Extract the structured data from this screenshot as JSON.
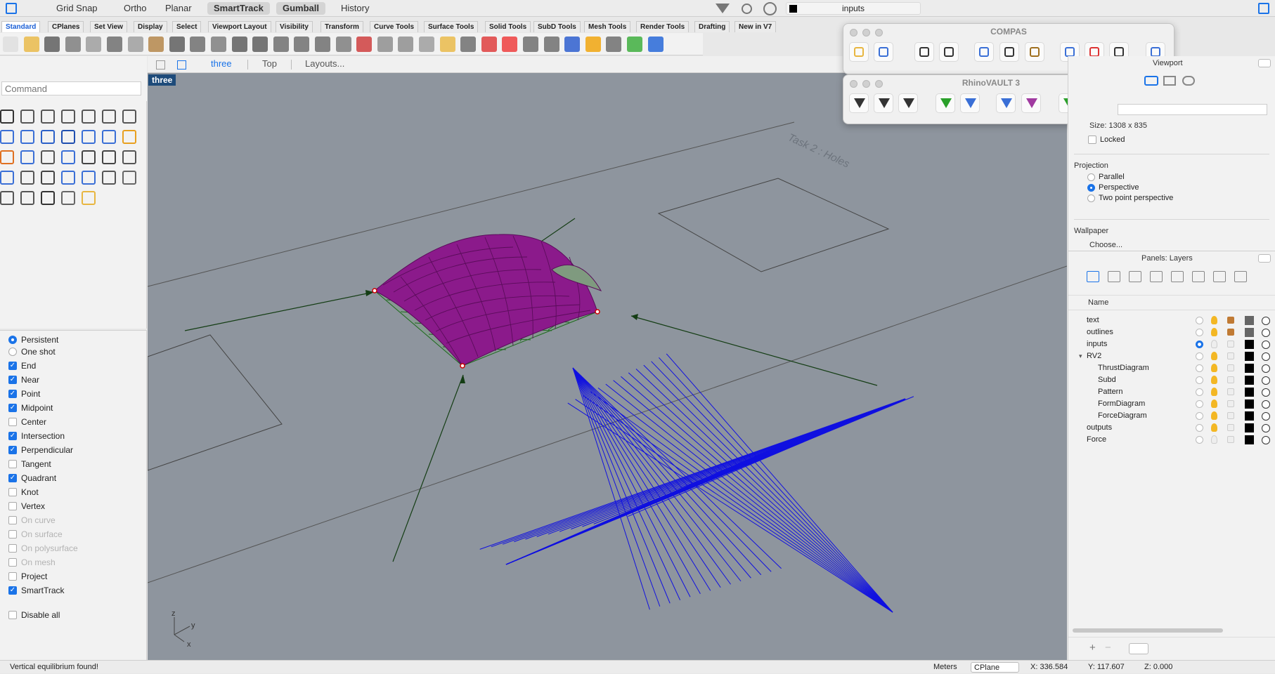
{
  "topbar": {
    "buttons": [
      {
        "label": "Grid Snap",
        "on": false
      },
      {
        "label": "Ortho",
        "on": false
      },
      {
        "label": "Planar",
        "on": false
      },
      {
        "label": "SmartTrack",
        "on": true
      },
      {
        "label": "Gumball",
        "on": true
      },
      {
        "label": "History",
        "on": false
      }
    ],
    "current_layer": "inputs"
  },
  "tabs": [
    "Standard",
    "CPlanes",
    "Set View",
    "Display",
    "Select",
    "Viewport Layout",
    "Visibility",
    "Transform",
    "Curve Tools",
    "Surface Tools",
    "Solid Tools",
    "SubD Tools",
    "Mesh Tools",
    "Render Tools",
    "Drafting",
    "New in V7"
  ],
  "command": {
    "placeholder": "Command"
  },
  "viewport_tabs": {
    "active": "three",
    "items": [
      "three",
      "Top",
      "Layouts..."
    ]
  },
  "viewport": {
    "label": "three",
    "watermark": "Task 2 : Holes",
    "axis_labels": {
      "z": "z",
      "y": "y",
      "x": "x"
    }
  },
  "osnap": {
    "mode": [
      {
        "label": "Persistent",
        "on": true
      },
      {
        "label": "One shot",
        "on": false
      }
    ],
    "items": [
      {
        "label": "End",
        "on": true,
        "dim": false
      },
      {
        "label": "Near",
        "on": true,
        "dim": false
      },
      {
        "label": "Point",
        "on": true,
        "dim": false
      },
      {
        "label": "Midpoint",
        "on": true,
        "dim": false
      },
      {
        "label": "Center",
        "on": false,
        "dim": false
      },
      {
        "label": "Intersection",
        "on": true,
        "dim": false
      },
      {
        "label": "Perpendicular",
        "on": true,
        "dim": false
      },
      {
        "label": "Tangent",
        "on": false,
        "dim": false
      },
      {
        "label": "Quadrant",
        "on": true,
        "dim": false
      },
      {
        "label": "Knot",
        "on": false,
        "dim": false
      },
      {
        "label": "Vertex",
        "on": false,
        "dim": false
      },
      {
        "label": "On curve",
        "on": false,
        "dim": true
      },
      {
        "label": "On surface",
        "on": false,
        "dim": true
      },
      {
        "label": "On polysurface",
        "on": false,
        "dim": true
      },
      {
        "label": "On mesh",
        "on": false,
        "dim": true
      },
      {
        "label": "Project",
        "on": false,
        "dim": false
      },
      {
        "label": "SmartTrack",
        "on": true,
        "dim": false
      }
    ],
    "disable_all": "Disable all"
  },
  "compas": {
    "title": "COMPAS"
  },
  "rhinovault": {
    "title": "RhinoVAULT 3"
  },
  "props": {
    "viewport_label": "Viewport",
    "size": "Size:  1308 x 835",
    "locked": "Locked",
    "projection_label": "Projection",
    "projections": [
      {
        "label": "Parallel",
        "on": false
      },
      {
        "label": "Perspective",
        "on": true
      },
      {
        "label": "Two point perspective",
        "on": false
      }
    ],
    "wallpaper_label": "Wallpaper",
    "wallpaper_choose": "Choose..."
  },
  "layers": {
    "title": "Panels: Layers",
    "name_header": "Name",
    "rows": [
      {
        "name": "text",
        "indent": 0,
        "current": false,
        "on": true,
        "locked": true,
        "color": "#666666"
      },
      {
        "name": "outlines",
        "indent": 0,
        "current": false,
        "on": true,
        "locked": true,
        "color": "#666666"
      },
      {
        "name": "inputs",
        "indent": 0,
        "current": true,
        "on": false,
        "locked": false,
        "color": "#000000"
      },
      {
        "name": "RV2",
        "indent": 0,
        "current": false,
        "on": true,
        "locked": false,
        "color": "#000000",
        "expanded": true
      },
      {
        "name": "ThrustDiagram",
        "indent": 1,
        "current": false,
        "on": true,
        "locked": false,
        "color": "#000000"
      },
      {
        "name": "Subd",
        "indent": 1,
        "current": false,
        "on": true,
        "locked": false,
        "color": "#000000"
      },
      {
        "name": "Pattern",
        "indent": 1,
        "current": false,
        "on": true,
        "locked": false,
        "color": "#000000"
      },
      {
        "name": "FormDiagram",
        "indent": 1,
        "current": false,
        "on": true,
        "locked": false,
        "color": "#000000"
      },
      {
        "name": "ForceDiagram",
        "indent": 1,
        "current": false,
        "on": true,
        "locked": false,
        "color": "#000000"
      },
      {
        "name": "outputs",
        "indent": 0,
        "current": false,
        "on": true,
        "locked": false,
        "color": "#000000"
      },
      {
        "name": "Force",
        "indent": 0,
        "current": false,
        "on": false,
        "locked": false,
        "color": "#000000"
      }
    ]
  },
  "status": {
    "message": "Vertical equilibrium found!",
    "units": "Meters",
    "cplane": "CPlane",
    "x": "X: 336.584",
    "y": "Y: 117.607",
    "z": "Z: 0.000"
  }
}
